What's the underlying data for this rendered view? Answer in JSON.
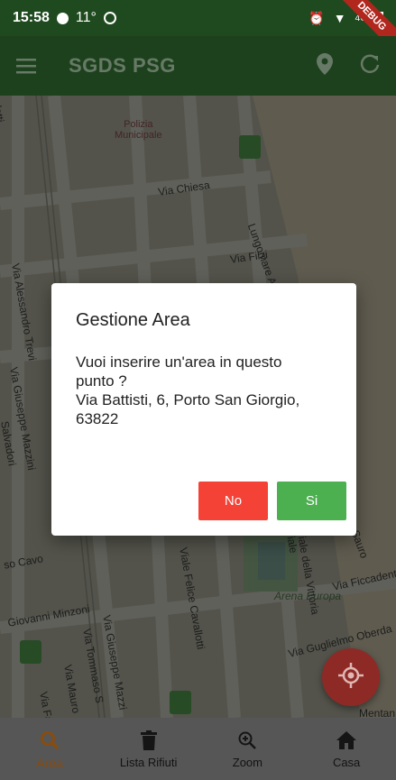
{
  "status_bar": {
    "time": "15:58",
    "temperature": "11°",
    "debug_label": "DEBUG",
    "network": "4G"
  },
  "app_bar": {
    "title": "SGDS PSG"
  },
  "map": {
    "labels": {
      "polizia": "Polizia\nMunicipale",
      "via_chiesa": "Via Chiesa",
      "via_filzi": "Via Filzi",
      "lungomare": "Lungomare Anto",
      "alessandro": "Via Alessandro Trevi",
      "giuseppe_mazzini": "Via Giuseppe Mazzini",
      "salvadori": "Salvadori",
      "cavour": "so Cavo",
      "giovanni": "Giovanni Minzoni",
      "via_giuseppe": "Via Giuseppe Mazzi",
      "via_tommaso": "Via Tommaso S",
      "via_mauro": "Via Mauro",
      "via_fausto": "Via Fausto",
      "felice": "Viale Felice Cavallotti",
      "vittoria": "Viale della Vittoria",
      "arena": "Arena Europa",
      "ficcadenti": "Via Ficcadenti",
      "guglielmo": "Via Guglielmo Oberda",
      "mentana": "Mentan",
      "sauro": "Sauro",
      "viale_left": "Viale",
      "lotti": "lotti"
    }
  },
  "dialog": {
    "title": "Gestione Area",
    "message": "Vuoi inserire un'area in questo\npunto ?\nVia Battisti, 6, Porto San Giorgio,\n63822",
    "no_label": "No",
    "si_label": "Si"
  },
  "bottom_nav": [
    {
      "label": "Area",
      "icon": "search-icon",
      "active": true
    },
    {
      "label": "Lista Rifiuti",
      "icon": "trash-icon",
      "active": false
    },
    {
      "label": "Zoom",
      "icon": "zoom-in-icon",
      "active": false
    },
    {
      "label": "Casa",
      "icon": "home-icon",
      "active": false
    }
  ],
  "colors": {
    "app_bar": "#2f6a2e",
    "no_button": "#f44336",
    "si_button": "#4caf50",
    "fab": "#8e2a26",
    "active_nav": "#8a4b11"
  }
}
